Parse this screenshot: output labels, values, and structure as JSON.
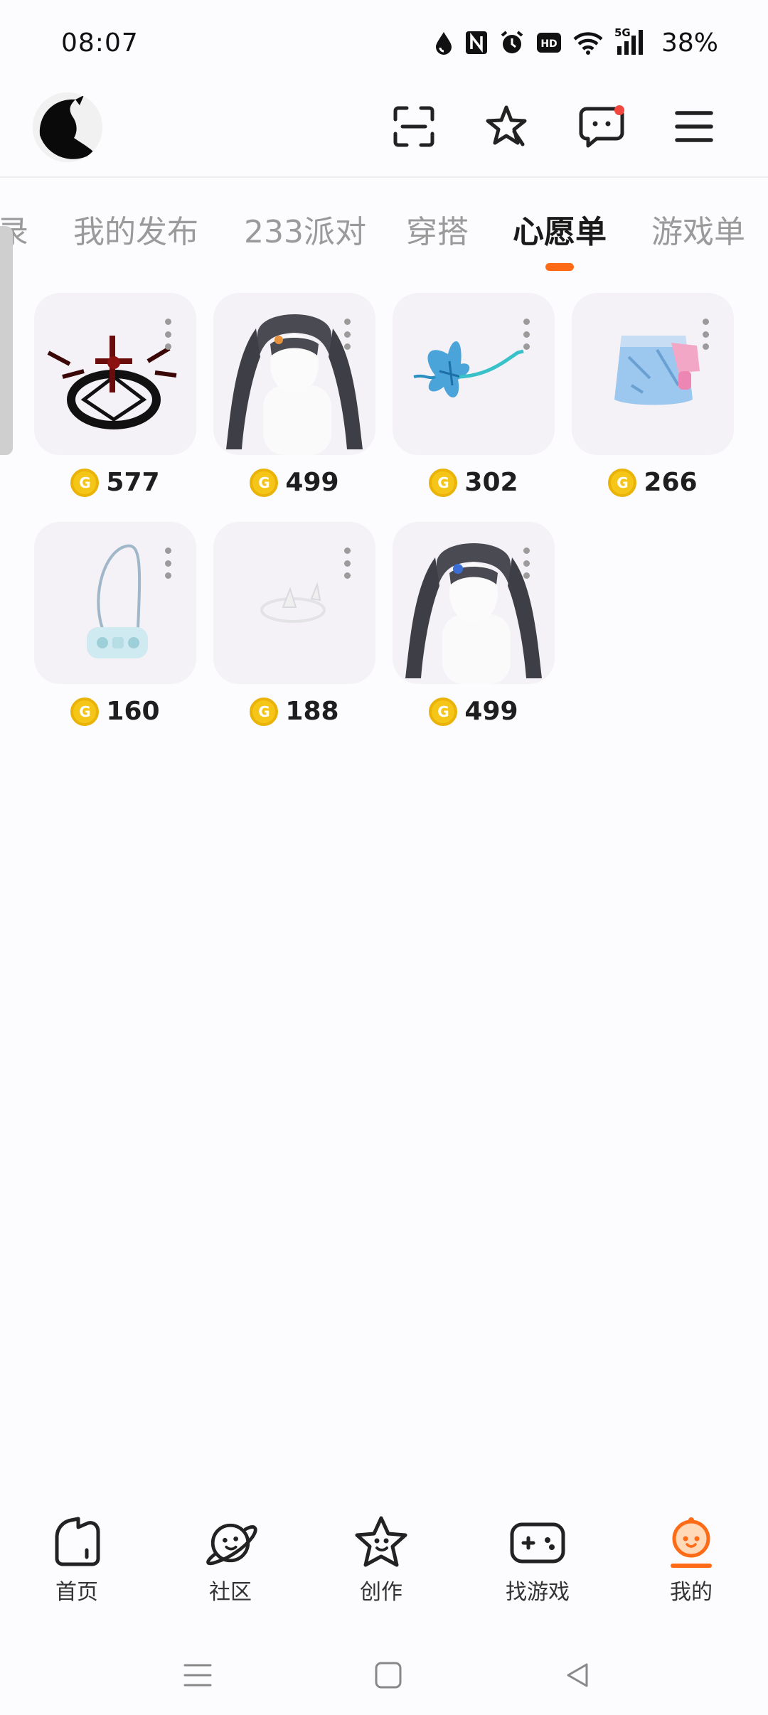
{
  "status_bar": {
    "time": "08:07",
    "network_label": "5G",
    "battery": "38%",
    "icons": [
      "drop-icon",
      "nfc-icon",
      "alarm-icon",
      "hd-icon",
      "wifi-icon",
      "signal-icon"
    ]
  },
  "header": {
    "icons": [
      "scan-icon",
      "star-icon",
      "message-icon",
      "menu-icon"
    ],
    "has_notification": true
  },
  "tabs": [
    {
      "label": "录"
    },
    {
      "label": "我的发布"
    },
    {
      "label": "233派对"
    },
    {
      "label": "穿搭"
    },
    {
      "label": "心愿单",
      "active": true
    },
    {
      "label": "游戏单"
    }
  ],
  "wishlist": {
    "coin_symbol": "G",
    "items": [
      {
        "name": "dark-circle-item",
        "price": "577"
      },
      {
        "name": "twin-tail-hair-item",
        "price": "499"
      },
      {
        "name": "blue-butterfly-item",
        "price": "302"
      },
      {
        "name": "denim-skirt-item",
        "price": "266"
      },
      {
        "name": "handheld-bag-item",
        "price": "160"
      },
      {
        "name": "white-accessory-item",
        "price": "188"
      },
      {
        "name": "twin-tail-hair-blue-clip-item",
        "price": "499"
      }
    ]
  },
  "bottom_nav": [
    {
      "label": "首页",
      "icon": "home-icon"
    },
    {
      "label": "社区",
      "icon": "planet-icon"
    },
    {
      "label": "创作",
      "icon": "star-face-icon"
    },
    {
      "label": "找游戏",
      "icon": "gamepad-icon"
    },
    {
      "label": "我的",
      "icon": "profile-icon",
      "active": true
    }
  ],
  "colors": {
    "accent": "#ff6a16",
    "coin": "#f5c518",
    "notification": "#f2473f"
  }
}
